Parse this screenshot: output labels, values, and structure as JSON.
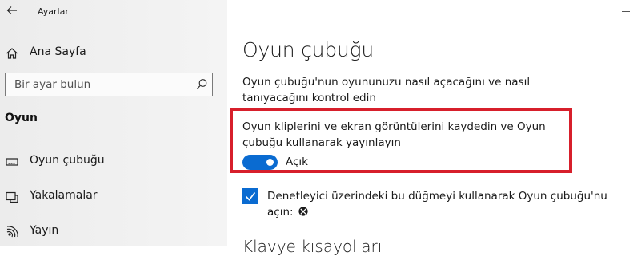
{
  "window": {
    "app_title": "Ayarlar"
  },
  "sidebar": {
    "home": {
      "label": "Ana Sayfa",
      "icon": "home-icon"
    },
    "search": {
      "placeholder": "Bir ayar bulun",
      "icon": "search-icon"
    },
    "section_title": "Oyun",
    "items": [
      {
        "label": "Oyun çubuğu",
        "icon": "game-bar-icon"
      },
      {
        "label": "Yakalamalar",
        "icon": "captures-icon"
      },
      {
        "label": "Yayın",
        "icon": "broadcast-icon"
      }
    ]
  },
  "main": {
    "title": "Oyun çubuğu",
    "description": "Oyun çubuğu'nun oyununuzu nasıl açacağını ve nasıl tanıyacağını kontrol edin",
    "record_setting": {
      "text": "Oyun kliplerini ve ekran görüntülerini kaydedin ve Oyun çubuğu kullanarak yayınlayın",
      "toggle_state": "on",
      "toggle_label": "Açık"
    },
    "controller_checkbox": {
      "checked": true,
      "text": "Denetleyici üzerindeki bu düğmeyi kullanarak Oyun çubuğu'nu açın:",
      "icon": "xbox-icon"
    },
    "keyboard_heading": "Klavye kısayolları"
  },
  "colors": {
    "accent": "#0a6bd1",
    "highlight_border": "#d71f2b",
    "sidebar_bg": "#f0f0f0"
  }
}
